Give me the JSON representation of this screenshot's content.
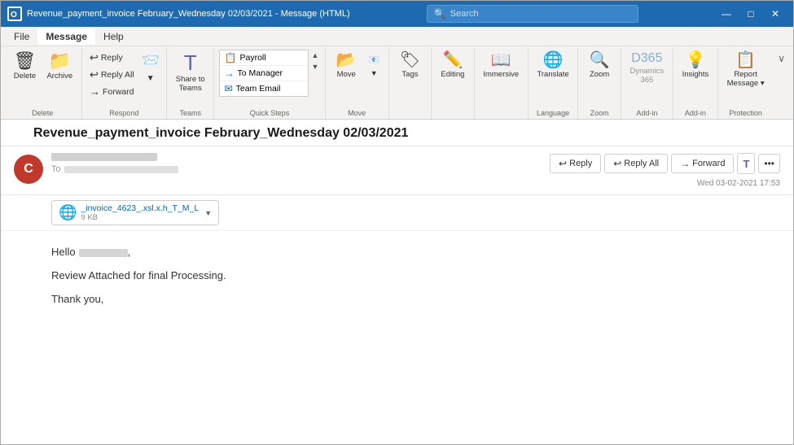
{
  "titlebar": {
    "app_icon": "O",
    "title": "Revenue_payment_invoice February_Wednesday 02/03/2021 - Message (HTML)",
    "search_placeholder": "Search",
    "minimize": "─",
    "maximize": "□",
    "close": "✕"
  },
  "menubar": {
    "items": [
      "File",
      "Message",
      "Help"
    ]
  },
  "ribbon": {
    "groups": [
      {
        "label": "Delete",
        "buttons": [
          {
            "icon": "🗑",
            "label": "Delete"
          },
          {
            "icon": "📁",
            "label": "Archive"
          }
        ]
      },
      {
        "label": "Respond",
        "small_buttons": [
          {
            "icon": "↩",
            "label": "Reply"
          },
          {
            "icon": "↩↩",
            "label": "Reply All"
          },
          {
            "icon": "→",
            "label": "Forward"
          }
        ]
      },
      {
        "label": "Teams",
        "buttons": [
          {
            "icon": "T",
            "label": "Share to Teams"
          }
        ]
      },
      {
        "label": "Quick Steps",
        "items": [
          "Payroll",
          "To Manager",
          "Team Email"
        ]
      },
      {
        "label": "Move",
        "buttons": [
          {
            "icon": "→📁",
            "label": "Move"
          }
        ]
      },
      {
        "label": "",
        "buttons": [
          {
            "icon": "🏷",
            "label": "Tags"
          }
        ]
      },
      {
        "label": "",
        "buttons": [
          {
            "icon": "✏",
            "label": "Editing"
          }
        ]
      },
      {
        "label": "",
        "buttons": [
          {
            "icon": "📖",
            "label": "Immersive"
          }
        ]
      },
      {
        "label": "Language",
        "buttons": [
          {
            "icon": "🔤",
            "label": "Translate"
          }
        ]
      },
      {
        "label": "Zoom",
        "buttons": [
          {
            "icon": "🔍",
            "label": "Zoom"
          }
        ]
      },
      {
        "label": "Add-in",
        "buttons": [
          {
            "icon": "D365",
            "label": "Dynamics 365"
          }
        ]
      },
      {
        "label": "Add-in",
        "buttons": [
          {
            "icon": "💡",
            "label": "Insights"
          }
        ]
      },
      {
        "label": "Protection",
        "buttons": [
          {
            "icon": "📋",
            "label": "Report Message"
          }
        ]
      }
    ]
  },
  "email": {
    "subject": "Revenue_payment_invoice February_Wednesday 02/03/2021",
    "sender_initial": "C",
    "sender_color": "#c0392b",
    "to_label": "To",
    "timestamp": "Wed 03-02-2021 17:53",
    "attachment": {
      "name": "_invoice_4623_.xsl.x.h_T_M_L",
      "size": "9 KB",
      "icon": "🌐"
    },
    "body_lines": [
      "Hello",
      "Review Attached for final Processing.",
      "Thank you,"
    ],
    "actions": {
      "reply": "Reply",
      "reply_all": "Reply All",
      "forward": "Forward"
    }
  }
}
